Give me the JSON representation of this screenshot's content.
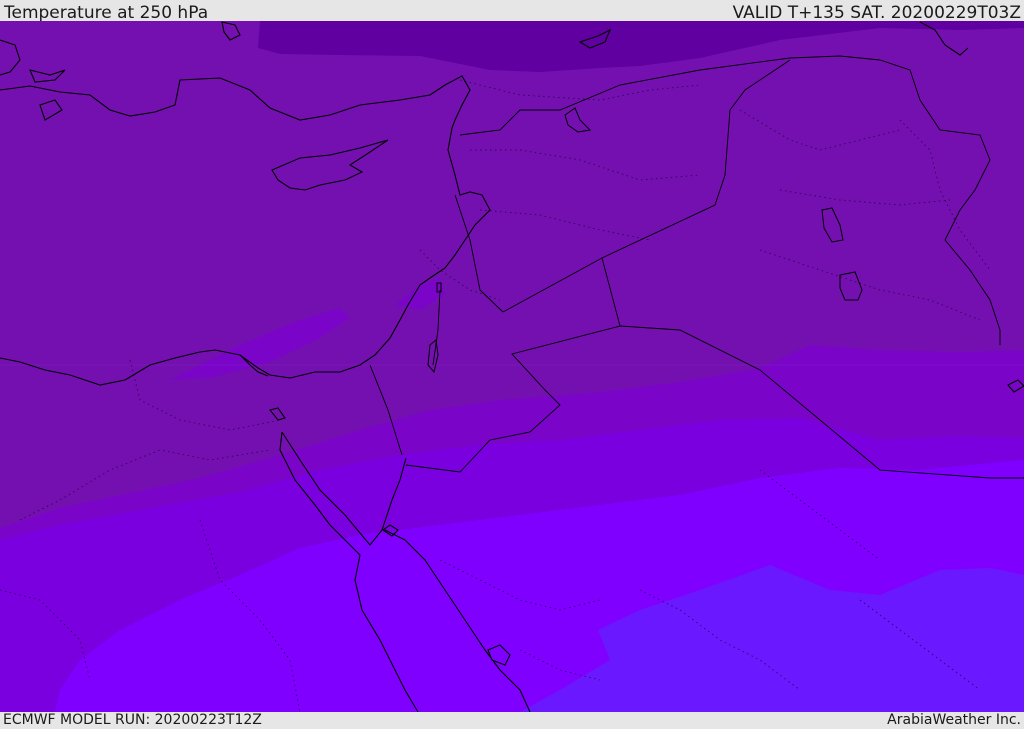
{
  "header": {
    "title": "Temperature at 250 hPa",
    "valid": "VALID T+135 SAT. 20200229T03Z"
  },
  "footer": {
    "model_run": "ECMWF MODEL RUN: 20200223T12Z",
    "credit": "ArabiaWeather Inc."
  },
  "colors": {
    "band_coldest": "#6000a0",
    "band_cold": "#7410b0",
    "band_mid": "#7a05c8",
    "band_warm": "#7a00e0",
    "band_warmer": "#8000ff",
    "band_warmest": "#6a18ff",
    "coastline": "#000000"
  }
}
